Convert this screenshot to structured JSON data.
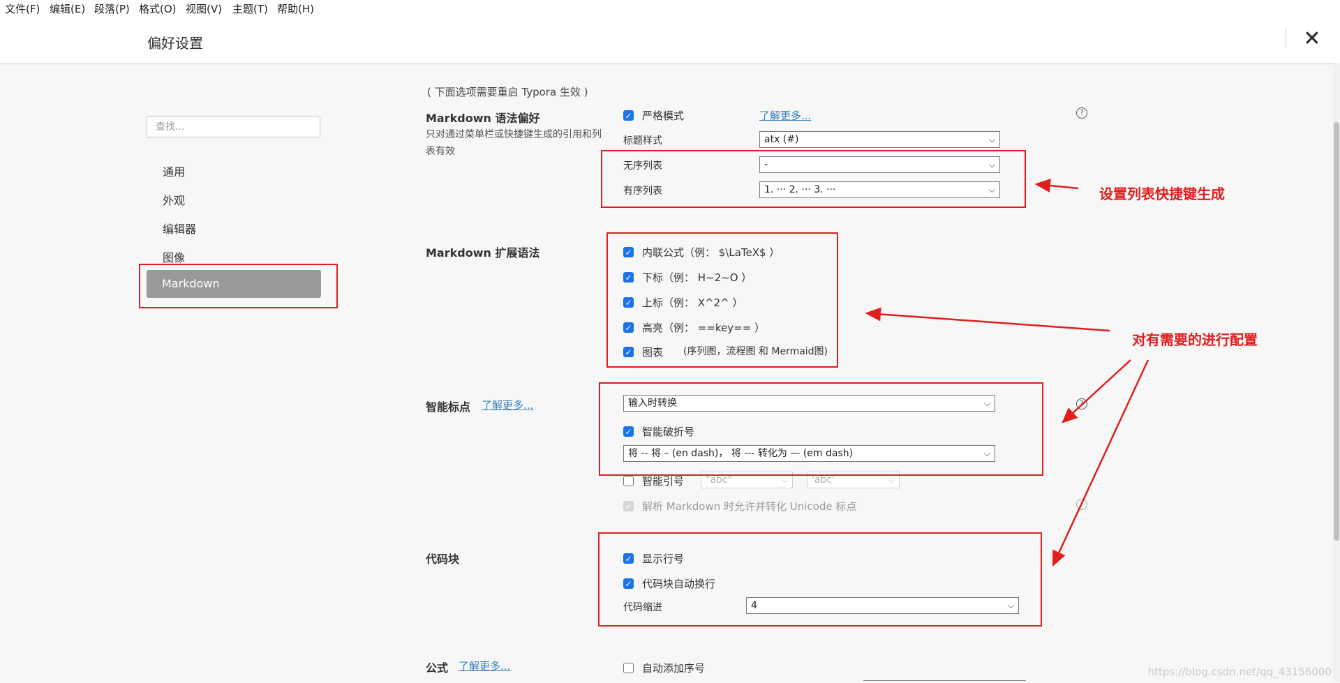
{
  "menubar": {
    "items": [
      "文件(F)",
      "编辑(E)",
      "段落(P)",
      "格式(O)",
      "视图(V)",
      "主题(T)",
      "帮助(H)"
    ]
  },
  "header": {
    "title": "偏好设置",
    "close_label": "✕"
  },
  "sidebar": {
    "search_placeholder": "查找...",
    "items": [
      "通用",
      "外观",
      "编辑器",
      "图像"
    ],
    "active_item": "Markdown"
  },
  "restart_note": "( 下面选项需要重启 Typora 生效 )",
  "markdown_syntax": {
    "title": "Markdown 语法偏好",
    "desc": "只对通过菜单栏或快捷键生成的引用和列表有效",
    "strict_mode": {
      "label": "严格模式",
      "checked": true
    },
    "learn_more": "了解更多...",
    "heading_style": {
      "label": "标题样式",
      "value": "atx (#)"
    },
    "unordered_list": {
      "label": "无序列表",
      "value": "-"
    },
    "ordered_list": {
      "label": "有序列表",
      "value": "1. ··· 2. ··· 3. ···"
    }
  },
  "markdown_ext": {
    "title": "Markdown 扩展语法",
    "options": [
      {
        "label": "内联公式（例： $\\LaTeX$ ）",
        "checked": true
      },
      {
        "label": "下标（例： H~2~O ）",
        "checked": true
      },
      {
        "label": "上标（例： X^2^ ）",
        "checked": true
      },
      {
        "label": "高亮（例： ==key== ）",
        "checked": true
      },
      {
        "label": "图表",
        "checked": true
      }
    ],
    "diagram_hint": "(序列图，流程图 和 Mermaid图)"
  },
  "smart_punct": {
    "title": "智能标点",
    "learn_more": "了解更多...",
    "mode": "输入时转换",
    "smart_dash": {
      "label": "智能破折号",
      "checked": true
    },
    "dash_mode": "将 -- 将 – (en dash)， 将 --- 转化为 — (em dash)",
    "smart_quotes": {
      "label": "智能引号",
      "checked": false
    },
    "double_quote": "\"abc\"",
    "single_quote": "'abc'",
    "unicode": {
      "label": "解析 Markdown 时允许并转化 Unicode 标点",
      "checked": true
    }
  },
  "code_block": {
    "title": "代码块",
    "line_numbers": {
      "label": "显示行号",
      "checked": true
    },
    "auto_wrap": {
      "label": "代码块自动换行",
      "checked": true
    },
    "indent": {
      "label": "代码缩进",
      "value": "4"
    }
  },
  "math": {
    "title": "公式",
    "learn_more": "了解更多...",
    "auto_number": {
      "label": "自动添加序号",
      "checked": false
    }
  },
  "annotations": {
    "list_shortcut": "设置列表快捷键生成",
    "configure": "对有需要的进行配置"
  },
  "help_symbol": "?",
  "checkmark": "✓",
  "chevron": "⌵",
  "watermark": "https://blog.csdn.net/qq_43156000",
  "colors": {
    "accent": "#1a73e8",
    "annotation": "#e01e1e",
    "active_nav": "#999999"
  }
}
